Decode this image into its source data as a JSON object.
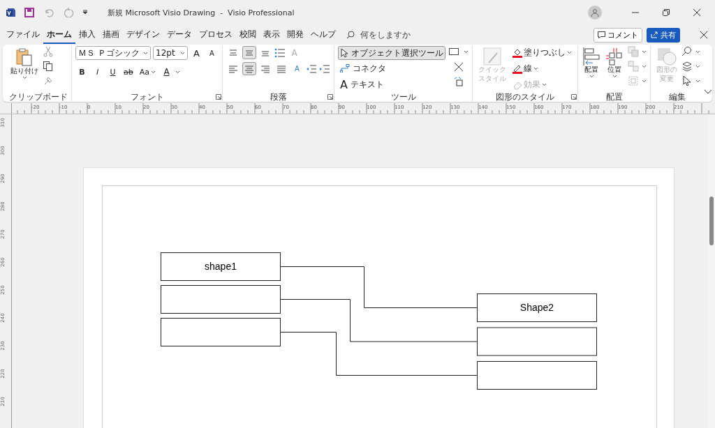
{
  "window": {
    "title": "新規 Microsoft Visio Drawing  -  Visio Professional"
  },
  "tabs": [
    {
      "label": "ファイル",
      "selected": false
    },
    {
      "label": "ホーム",
      "selected": true
    },
    {
      "label": "挿入",
      "selected": false
    },
    {
      "label": "描画",
      "selected": false
    },
    {
      "label": "デザイン",
      "selected": false
    },
    {
      "label": "データ",
      "selected": false
    },
    {
      "label": "プロセス",
      "selected": false
    },
    {
      "label": "校閲",
      "selected": false
    },
    {
      "label": "表示",
      "selected": false
    },
    {
      "label": "開発",
      "selected": false
    },
    {
      "label": "ヘルプ",
      "selected": false
    }
  ],
  "search": {
    "placeholder": "何をしますか"
  },
  "comment_button": "コメント",
  "share_button": "共有",
  "clipboard": {
    "paste": "貼り付け",
    "label": "クリップボード"
  },
  "font": {
    "family": "ＭＳ Ｐゴシック",
    "size": "12pt",
    "grow": "A",
    "shrink": "A",
    "styles": [
      "B",
      "I",
      "U",
      "ab",
      "Aa"
    ],
    "color_glyph": "A",
    "label": "フォント"
  },
  "paragraph": {
    "vertical_align": [
      {
        "selected": false
      },
      {
        "selected": true
      },
      {
        "selected": false
      }
    ],
    "horizontal_align": [
      {
        "selected": false
      },
      {
        "selected": true
      },
      {
        "selected": false
      },
      {
        "selected": false
      }
    ],
    "rotate_glyph": "A",
    "direction_glyph": "A",
    "label": "段落"
  },
  "tools": {
    "items": [
      {
        "kind": "pointer",
        "label": "オブジェクト選択ツール",
        "selected": true
      },
      {
        "kind": "connector",
        "label": "コネクタ",
        "selected": false
      },
      {
        "kind": "text",
        "glyph": "A",
        "label": "テキスト",
        "selected": false
      }
    ],
    "label": "ツール"
  },
  "shape_styles": {
    "quick_style": {
      "label": "クイックスタイル",
      "disabled": true
    },
    "items": [
      {
        "kind": "fill",
        "label": "塗りつぶし",
        "disabled": false
      },
      {
        "kind": "line",
        "label": "線",
        "disabled": false
      },
      {
        "kind": "effect",
        "label": "効果",
        "disabled": true
      }
    ],
    "label": "図形のスタイル"
  },
  "arrange": {
    "align": "配置",
    "position": "位置",
    "label": "配置"
  },
  "edit": {
    "change_shape": {
      "label": "図形の変更",
      "disabled": true
    },
    "label": "編集"
  },
  "ruler": {
    "horizontal": [
      "-20",
      "-10",
      "0",
      "10",
      "20",
      "30",
      "40",
      "50",
      "60",
      "70",
      "80",
      "90",
      "100",
      "110",
      "120",
      "130",
      "140",
      "150",
      "160",
      "170",
      "180",
      "190",
      "200",
      "210"
    ],
    "vertical": [
      "310",
      "300",
      "290",
      "280",
      "270",
      "260",
      "250",
      "240",
      "230",
      "220",
      "210"
    ]
  },
  "diagram": {
    "left_shapes": [
      {
        "kind": "rectangle",
        "text": "shape1"
      },
      {
        "kind": "rectangle"
      },
      {
        "kind": "rectangle"
      }
    ],
    "right_shapes": [
      {
        "kind": "rectangle",
        "text": "Shape2"
      },
      {
        "kind": "rectangle"
      },
      {
        "kind": "rectangle"
      }
    ]
  }
}
